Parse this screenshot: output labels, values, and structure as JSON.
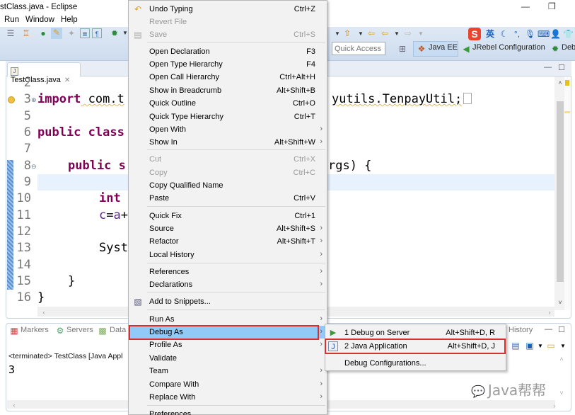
{
  "window": {
    "title": "stClass.java - Eclipse",
    "minimize_glyph": "—",
    "restore_glyph": "❐"
  },
  "menubar": [
    "Run",
    "Window",
    "Help"
  ],
  "toolbar": {
    "quick_access_placeholder": "Quick Access",
    "perspectives": [
      "Java EE",
      "JRebel Configuration",
      "Deb"
    ],
    "ime_label": "英"
  },
  "editor": {
    "tab_label": "TestClass.java",
    "tab_close_glyph": "✕",
    "line_numbers": [
      "2",
      "3",
      "5",
      "6",
      "7",
      "8",
      "9",
      "10",
      "11",
      "12",
      "13",
      "14",
      "15",
      "16"
    ],
    "lines": {
      "l3_kw": "import",
      "l3_rest_left": " com.t",
      "l3_rest_right": "yutils.TenpayUtil;",
      "l6_kw": "public class",
      "l8_kw": "public s",
      "l8_rest_right": "rgs) {",
      "l10_kw": "int",
      "l11_c": "c",
      "l11_eq": "=",
      "l11_a": "a",
      "l11_plus": "+",
      "l13": "Syst",
      "l15": "}",
      "l16": "}"
    }
  },
  "bottom_panel": {
    "tabs": [
      "Markers",
      "Servers",
      "Data"
    ],
    "right_tab": "History",
    "console_header": "<terminated> TestClass [Java Appl",
    "console_output": "3"
  },
  "context_menu": {
    "items": [
      {
        "label": "Undo Typing",
        "shortcut": "Ctrl+Z",
        "icon": "undo-icon"
      },
      {
        "label": "Revert File",
        "shortcut": "",
        "disabled": true
      },
      {
        "label": "Save",
        "shortcut": "Ctrl+S",
        "disabled": true,
        "icon": "save-icon"
      },
      {
        "label": "Open Declaration",
        "shortcut": "F3"
      },
      {
        "label": "Open Type Hierarchy",
        "shortcut": "F4"
      },
      {
        "label": "Open Call Hierarchy",
        "shortcut": "Ctrl+Alt+H"
      },
      {
        "label": "Show in Breadcrumb",
        "shortcut": "Alt+Shift+B"
      },
      {
        "label": "Quick Outline",
        "shortcut": "Ctrl+O"
      },
      {
        "label": "Quick Type Hierarchy",
        "shortcut": "Ctrl+T"
      },
      {
        "label": "Open With",
        "shortcut": "",
        "submenu": true
      },
      {
        "label": "Show In",
        "shortcut": "Alt+Shift+W",
        "submenu": true
      },
      {
        "label": "Cut",
        "shortcut": "Ctrl+X",
        "disabled": true
      },
      {
        "label": "Copy",
        "shortcut": "Ctrl+C",
        "disabled": true
      },
      {
        "label": "Copy Qualified Name",
        "shortcut": ""
      },
      {
        "label": "Paste",
        "shortcut": "Ctrl+V"
      },
      {
        "label": "Quick Fix",
        "shortcut": "Ctrl+1"
      },
      {
        "label": "Source",
        "shortcut": "Alt+Shift+S",
        "submenu": true
      },
      {
        "label": "Refactor",
        "shortcut": "Alt+Shift+T",
        "submenu": true
      },
      {
        "label": "Local History",
        "shortcut": "",
        "submenu": true
      },
      {
        "label": "References",
        "shortcut": "",
        "submenu": true
      },
      {
        "label": "Declarations",
        "shortcut": "",
        "submenu": true
      },
      {
        "label": "Add to Snippets...",
        "shortcut": "",
        "icon": "snippet-icon"
      },
      {
        "label": "Run As",
        "shortcut": "",
        "submenu": true
      },
      {
        "label": "Debug As",
        "shortcut": "",
        "submenu": true,
        "highlighted": true
      },
      {
        "label": "Profile As",
        "shortcut": "",
        "submenu": true
      },
      {
        "label": "Validate",
        "shortcut": ""
      },
      {
        "label": "Team",
        "shortcut": "",
        "submenu": true
      },
      {
        "label": "Compare With",
        "shortcut": "",
        "submenu": true
      },
      {
        "label": "Replace With",
        "shortcut": "",
        "submenu": true
      },
      {
        "label": "Preferences...",
        "shortcut": ""
      }
    ],
    "submenu_arrow": "›"
  },
  "debug_submenu": {
    "items": [
      {
        "label": "1 Debug on Server",
        "shortcut": "Alt+Shift+D, R"
      },
      {
        "label": "2 Java Application",
        "shortcut": "Alt+Shift+D, J",
        "boxed": true
      },
      {
        "label": "Debug Configurations...",
        "shortcut": ""
      }
    ]
  },
  "watermark": "Java帮帮",
  "colors": {
    "keyword": "#7f0055",
    "menu_highlight": "#91c9f7",
    "annotation_red": "#d9302f",
    "current_line": "#e8f2fe"
  }
}
